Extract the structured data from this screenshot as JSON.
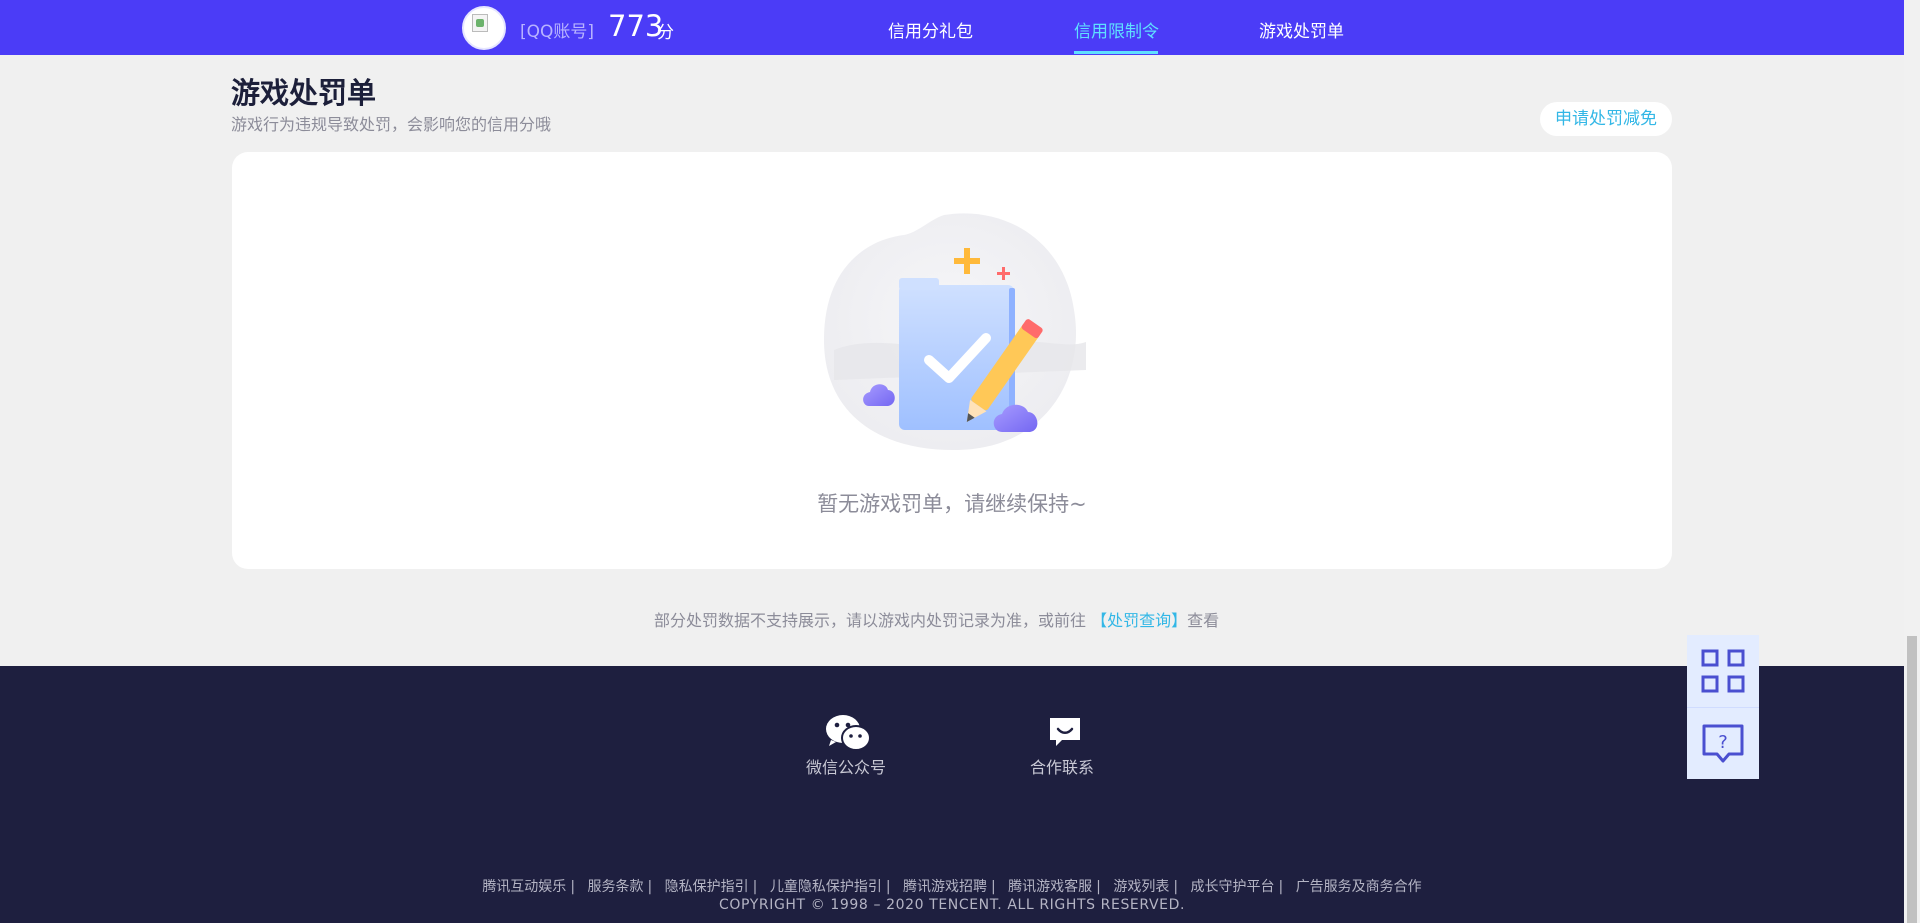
{
  "header": {
    "account_label": "[QQ账号]",
    "score": "773",
    "score_unit": "分",
    "nav": [
      {
        "label": "信用分礼包",
        "active": false
      },
      {
        "label": "信用限制令",
        "active": true
      },
      {
        "label": "游戏处罚单",
        "active": false
      }
    ]
  },
  "page": {
    "title": "游戏处罚单",
    "subtitle": "游戏行为违规导致处罚，会影响您的信用分哦",
    "appeal_button": "申请处罚减免",
    "empty_text": "暂无游戏罚单，请继续保持~",
    "notice_prefix": "部分处罚数据不支持展示，请以游戏内处罚记录为准，或前往",
    "notice_link": "【处罚查询】",
    "notice_suffix": "查看"
  },
  "footer": {
    "wechat_label": "微信公众号",
    "contact_label": "合作联系",
    "links": [
      "腾讯互动娱乐",
      "服务条款",
      "隐私保护指引",
      "儿童隐私保护指引",
      "腾讯游戏招聘",
      "腾讯游戏客服",
      "游戏列表",
      "成长守护平台",
      "广告服务及商务合作"
    ],
    "copyright": "COPYRIGHT © 1998 – 2020 TENCENT. ALL RIGHTS RESERVED."
  },
  "icons": {
    "avatar": "avatar-broken-image",
    "wechat": "wechat-icon",
    "contact": "chat-bubble-icon",
    "qrcode": "qrcode-icon",
    "help": "help-bubble-icon"
  },
  "colors": {
    "topbar": "#4b3cf7",
    "active_nav": "#5fe0ff",
    "link": "#33b7e6",
    "footer": "#1e1f3f",
    "page_bg": "#f0f0f0"
  }
}
